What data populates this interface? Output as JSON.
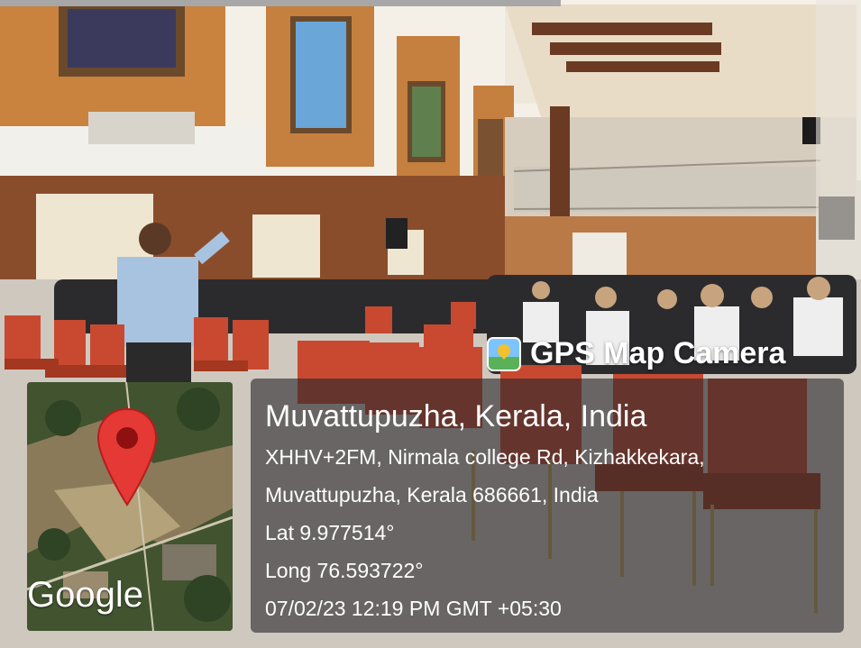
{
  "app_name": "GPS Map Camera",
  "place": "Muvattupuzha, Kerala, India",
  "address_line1": "XHHV+2FM, Nirmala college Rd, Kizhakkekara,",
  "address_line2": "Muvattupuzha, Kerala 686661, India",
  "latitude": "Lat 9.977514°",
  "longitude": "Long 76.593722°",
  "datetime": "07/02/23 12:19 PM GMT +05:30",
  "map_brand": "Google",
  "colors": {
    "pin": "#e53935",
    "card": "#28282c",
    "wall": "#b97a47",
    "chair": "#c8492f"
  }
}
